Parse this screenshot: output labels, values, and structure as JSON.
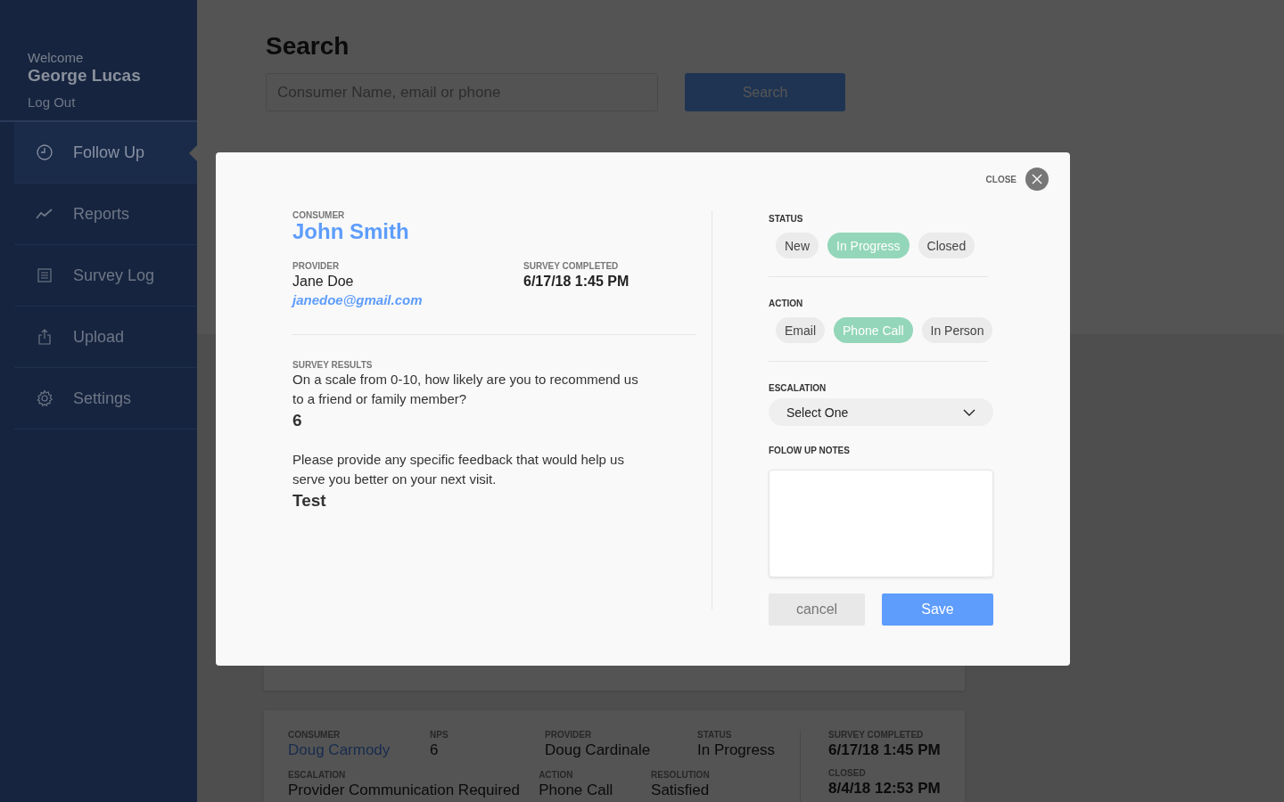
{
  "sidebar": {
    "welcome": "Welcome",
    "user": "George Lucas",
    "logout": "Log Out",
    "items": [
      {
        "label": "Follow Up",
        "selected": true
      },
      {
        "label": "Reports",
        "selected": false
      },
      {
        "label": "Survey Log",
        "selected": false
      },
      {
        "label": "Upload",
        "selected": false
      },
      {
        "label": "Settings",
        "selected": false
      }
    ]
  },
  "search": {
    "title": "Search",
    "placeholder": "Consumer Name, email or phone",
    "button": "Search"
  },
  "result_card": {
    "main_rows": [
      [
        {
          "label": "CONSUMER",
          "value": "Doug Carmody",
          "kind": "link"
        },
        {
          "label": "NPS",
          "value": "6",
          "kind": "text"
        },
        {
          "label": "PROVIDER",
          "value": "Doug Cardinale",
          "kind": "text"
        },
        {
          "label": "STATUS",
          "value": "In Progress",
          "kind": "text"
        }
      ],
      [
        {
          "label": "ESCALATION",
          "value": "Provider Communication Required",
          "kind": "wide"
        },
        {
          "label": "ACTION",
          "value": "Phone Call",
          "kind": "text"
        },
        {
          "label": "RESOLUTION",
          "value": "Satisfied",
          "kind": "text"
        }
      ]
    ],
    "side": [
      {
        "label": "SURVEY COMPLETED",
        "value": "6/17/18 1:45 PM"
      },
      {
        "label": "CLOSED",
        "value": "8/4/18 12:53 PM"
      }
    ]
  },
  "modal": {
    "close_label": "CLOSE",
    "consumer": {
      "label": "CONSUMER",
      "name": "John Smith"
    },
    "provider": {
      "label": "PROVIDER",
      "name": "Jane Doe",
      "email": "janedoe@gmail.com"
    },
    "survey_completed": {
      "label": "SURVEY COMPLETED",
      "value": "6/17/18 1:45 PM"
    },
    "survey": {
      "label": "SURVEY RESULTS",
      "questions": [
        {
          "question": "On a scale from 0-10, how likely are you to recommend us to a friend or family member?",
          "answer": "6"
        },
        {
          "question": "Please provide any specific feedback that would help us serve you better on your next visit.",
          "answer": "Test"
        }
      ]
    },
    "status": {
      "label": "STATUS",
      "options": [
        {
          "label": "New",
          "selected": false
        },
        {
          "label": "In Progress",
          "selected": true
        },
        {
          "label": "Closed",
          "selected": false
        }
      ]
    },
    "action": {
      "label": "ACTION",
      "options": [
        {
          "label": "Email",
          "selected": false
        },
        {
          "label": "Phone Call",
          "selected": true
        },
        {
          "label": "In Person",
          "selected": false
        }
      ]
    },
    "escalation": {
      "label": "ESCALATION",
      "value": "Select One"
    },
    "notes": {
      "label": "FOLOW UP NOTES"
    },
    "buttons": [
      {
        "label": "cancel",
        "kind": "secondary"
      },
      {
        "label": "Save",
        "kind": "primary"
      }
    ]
  }
}
